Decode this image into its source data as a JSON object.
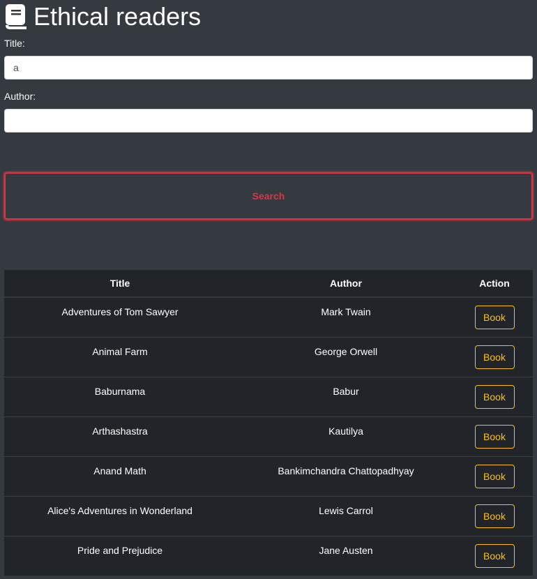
{
  "app": {
    "title": "Ethical readers",
    "icon": "book-icon"
  },
  "form": {
    "title_label": "Title:",
    "title_value": "a",
    "author_label": "Author:",
    "author_value": "",
    "search_label": "Search"
  },
  "colors": {
    "background": "#343a40",
    "table_bg": "#212529",
    "search_accent": "#dc3545",
    "book_accent": "#ffc107"
  },
  "table": {
    "headers": [
      "Title",
      "Author",
      "Action"
    ],
    "rows": [
      {
        "title": "Adventures of Tom Sawyer",
        "author": "Mark Twain",
        "action": "Book"
      },
      {
        "title": "Animal Farm",
        "author": "George Orwell",
        "action": "Book"
      },
      {
        "title": "Baburnama",
        "author": "Babur",
        "action": "Book"
      },
      {
        "title": "Arthashastra",
        "author": "Kautilya",
        "action": "Book"
      },
      {
        "title": "Anand Math",
        "author": "Bankimchandra Chattopadhyay",
        "action": "Book"
      },
      {
        "title": "Alice's Adventures in Wonderland",
        "author": "Lewis Carrol",
        "action": "Book"
      },
      {
        "title": "Pride and Prejudice",
        "author": "Jane Austen",
        "action": "Book"
      }
    ]
  }
}
